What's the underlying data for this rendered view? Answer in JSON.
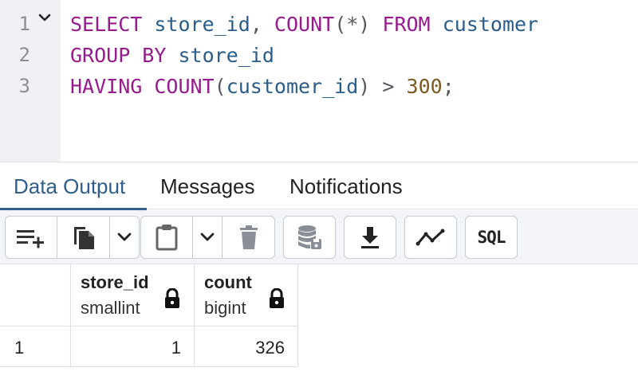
{
  "editor": {
    "line_numbers": [
      "1",
      "2",
      "3"
    ],
    "line1": {
      "kw1": "SELECT",
      "id1": "store_id",
      "comma": ",",
      "fn": "COUNT",
      "args": "(*)",
      "kw2": "FROM",
      "table": "customer"
    },
    "line2": {
      "kw": "GROUP BY",
      "id": "store_id"
    },
    "line3": {
      "kw": "HAVING",
      "fn": "COUNT",
      "open": "(",
      "arg": "customer_id",
      "close": ")",
      "op": ">",
      "num": "300",
      "semi": ";"
    }
  },
  "tabs": [
    {
      "label": "Data Output",
      "active": true
    },
    {
      "label": "Messages",
      "active": false
    },
    {
      "label": "Notifications",
      "active": false
    }
  ],
  "toolbar": {
    "sql_label": "SQL",
    "icons": [
      "add-row-icon",
      "copy-icon",
      "chevron-down-icon",
      "paste-icon",
      "chevron-down-icon",
      "delete-icon",
      "save-data-icon",
      "download-icon",
      "graph-icon",
      "sql-icon"
    ]
  },
  "result": {
    "columns": [
      {
        "name": "store_id",
        "type": "smallint"
      },
      {
        "name": "count",
        "type": "bigint"
      }
    ],
    "rows": [
      {
        "num": "1",
        "values": [
          "1",
          "326"
        ]
      }
    ]
  },
  "colors": {
    "accent": "#2f5d8c",
    "keyword": "#981a8e",
    "identifier": "#2a5d8a",
    "number": "#7c5a1e"
  }
}
